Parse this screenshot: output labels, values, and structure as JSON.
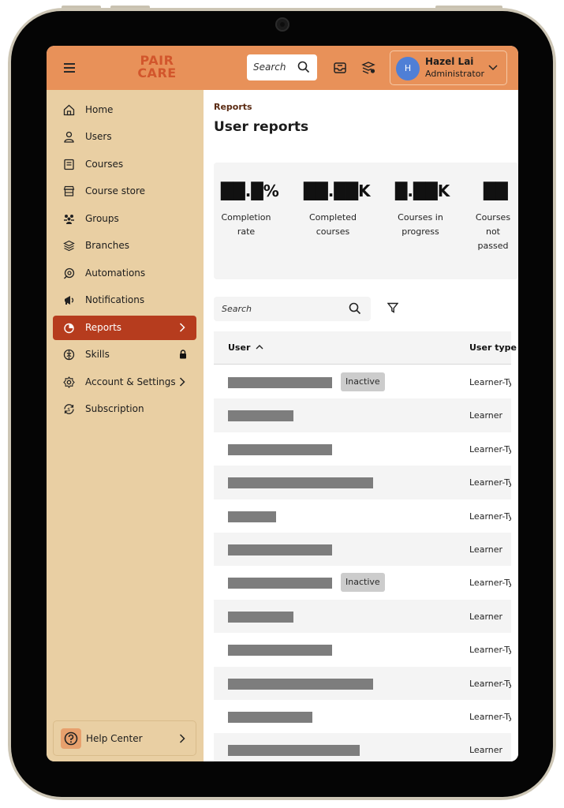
{
  "app": {
    "logo_line1": "PAIR",
    "logo_line2": "CARE"
  },
  "topbar": {
    "search_placeholder": "Search",
    "user_initial": "H",
    "user_name": "Hazel Lai",
    "user_role": "Administrator"
  },
  "sidebar": {
    "items": [
      {
        "label": "Home",
        "icon": "home-icon"
      },
      {
        "label": "Users",
        "icon": "user-icon"
      },
      {
        "label": "Courses",
        "icon": "book-icon"
      },
      {
        "label": "Course store",
        "icon": "store-icon"
      },
      {
        "label": "Groups",
        "icon": "groups-icon"
      },
      {
        "label": "Branches",
        "icon": "branches-icon"
      },
      {
        "label": "Automations",
        "icon": "automations-icon"
      },
      {
        "label": "Notifications",
        "icon": "megaphone-icon"
      },
      {
        "label": "Reports",
        "icon": "pie-chart-icon",
        "active": true
      },
      {
        "label": "Skills",
        "icon": "skills-icon"
      },
      {
        "label": "Account & Settings",
        "icon": "gear-icon"
      },
      {
        "label": "Subscription",
        "icon": "subscription-icon"
      }
    ],
    "help_label": "Help Center"
  },
  "main": {
    "breadcrumb": "Reports",
    "title": "User reports",
    "stats": [
      {
        "value": "██.█%",
        "label": "Completion rate"
      },
      {
        "value": "██.██K",
        "label": "Completed courses"
      },
      {
        "value": "█.██K",
        "label": "Courses in progress"
      },
      {
        "value": "██",
        "label": "Courses not passed"
      }
    ],
    "search_placeholder": "Search",
    "table": {
      "col_user": "User",
      "col_type": "User type",
      "rows": [
        {
          "name_redacted": true,
          "bar": 0.72,
          "badge": "Inactive",
          "type": "Learner-Type"
        },
        {
          "name_redacted": true,
          "bar": 0.45,
          "badge": "",
          "type": "Learner"
        },
        {
          "name_redacted": true,
          "bar": 0.72,
          "badge": "",
          "type": "Learner-Type"
        },
        {
          "name_redacted": true,
          "bar": 1.0,
          "badge": "",
          "type": "Learner-Type"
        },
        {
          "name_redacted": true,
          "bar": 0.33,
          "badge": "",
          "type": "Learner-Type"
        },
        {
          "name_redacted": true,
          "bar": 0.72,
          "badge": "",
          "type": "Learner"
        },
        {
          "name_redacted": true,
          "bar": 0.72,
          "badge": "Inactive",
          "type": "Learner-Type"
        },
        {
          "name_redacted": true,
          "bar": 0.45,
          "badge": "",
          "type": "Learner"
        },
        {
          "name_redacted": true,
          "bar": 0.72,
          "badge": "",
          "type": "Learner-Type"
        },
        {
          "name_redacted": true,
          "bar": 1.0,
          "badge": "",
          "type": "Learner-Type"
        },
        {
          "name_redacted": true,
          "bar": 0.58,
          "badge": "",
          "type": "Learner-Type"
        },
        {
          "name_redacted": true,
          "bar": 0.91,
          "badge": "",
          "type": "Learner"
        }
      ]
    }
  },
  "colors": {
    "topbar": "#e89159",
    "sidebar": "#e9cfa3",
    "active_item": "#b63c1e",
    "logo": "#d2562c",
    "avatar": "#4f7fd6"
  }
}
